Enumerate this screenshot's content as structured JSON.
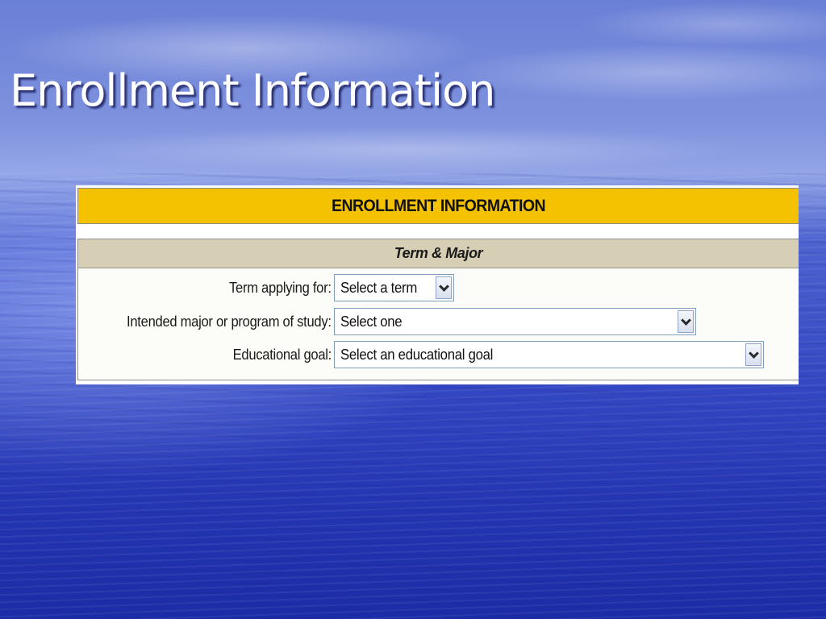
{
  "slide": {
    "title": "Enrollment Information"
  },
  "form": {
    "header": "ENROLLMENT INFORMATION",
    "section_title": "Term & Major",
    "fields": [
      {
        "label": "Term applying for:",
        "selected": "Select a term"
      },
      {
        "label": "Intended major or program of study:",
        "selected": "Select one"
      },
      {
        "label": "Educational goal:",
        "selected": "Select an educational goal"
      }
    ]
  },
  "colors": {
    "header_bg": "#f4c200",
    "section_header_bg": "#d6cfb5",
    "title_text": "#ffffff"
  },
  "icons": {
    "dropdown": "chevron-down-icon"
  }
}
